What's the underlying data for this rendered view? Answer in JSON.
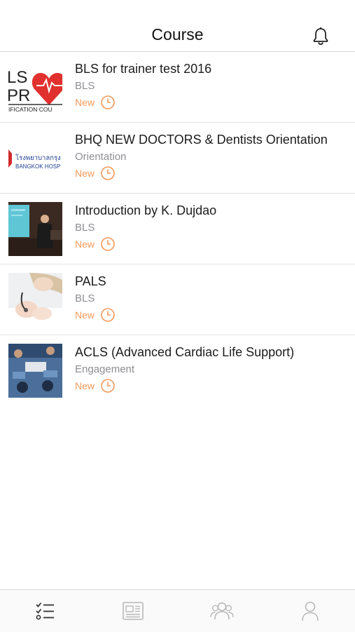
{
  "header": {
    "title": "Course",
    "bell_icon": "bell-icon"
  },
  "courses": [
    {
      "title": "BLS for trainer test 2016",
      "category": "BLS",
      "status": "New",
      "thumb_text": [
        "LS",
        "PR",
        "IFICATION COU"
      ]
    },
    {
      "title": "BHQ NEW DOCTORS & Dentists Orientation",
      "category": "Orientation",
      "status": "New",
      "thumb_text": [
        "โรงพยาบาลกรุง",
        "BANGKOK HOSP"
      ]
    },
    {
      "title": "Introduction by K. Dujdao",
      "category": "BLS",
      "status": "New"
    },
    {
      "title": "PALS",
      "category": "BLS",
      "status": "New"
    },
    {
      "title": "ACLS (Advanced Cardiac Life Support)",
      "category": "Engagement",
      "status": "New"
    }
  ],
  "tabbar": {
    "items": [
      {
        "icon": "checklist-icon",
        "active": true
      },
      {
        "icon": "newspaper-icon",
        "active": false
      },
      {
        "icon": "group-icon",
        "active": false
      },
      {
        "icon": "person-icon",
        "active": false
      }
    ]
  },
  "colors": {
    "accent": "#f39a5b",
    "secondary_text": "#8e8e93",
    "tab_inactive": "#b8b8b8",
    "tab_active": "#333333"
  }
}
